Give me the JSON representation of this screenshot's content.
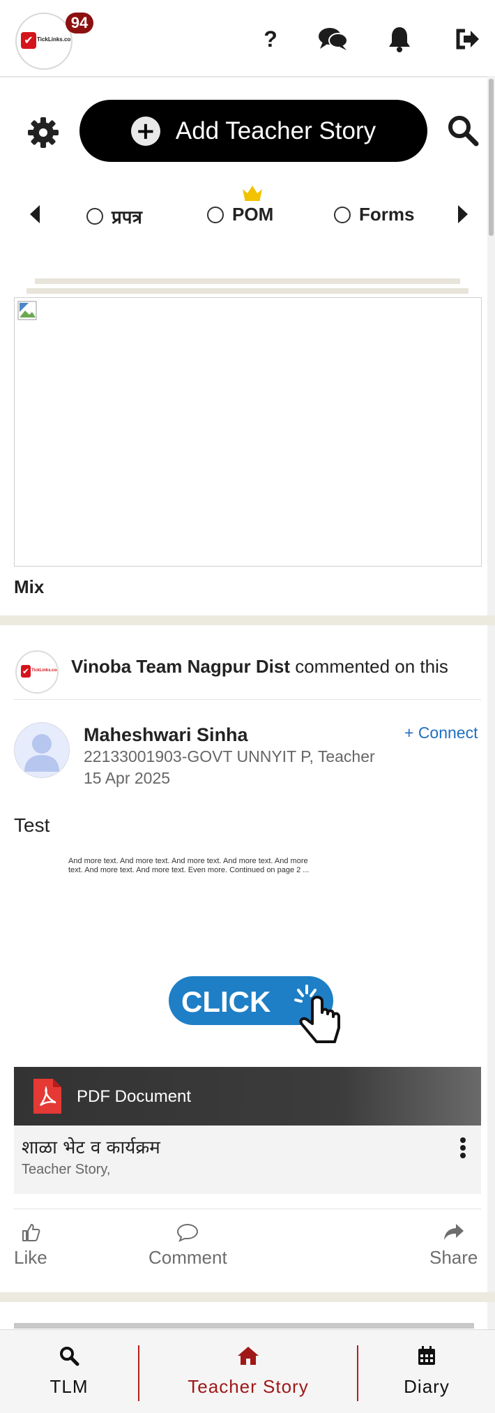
{
  "header": {
    "logo_text": "TickLinks.com",
    "notification_count": "94",
    "icons": [
      "help-icon",
      "chat-icon",
      "bell-icon",
      "logout-icon"
    ]
  },
  "actions": {
    "add_label": "Add Teacher Story"
  },
  "filters": {
    "items": [
      {
        "label": "प्रपत्र",
        "selected": false
      },
      {
        "label": "POM",
        "selected": false,
        "featured": true
      },
      {
        "label": "Forms",
        "selected": false
      }
    ]
  },
  "feed": {
    "card1": {
      "caption": "Mix"
    },
    "card2": {
      "actor": "Vinoba Team Nagpur Dist",
      "action_text": " commented on this",
      "author_name": "Maheshwari Sinha",
      "author_meta": "22133001903-GOVT UNNYIT P, Teacher",
      "date": "15 Apr 2025",
      "connect_label": "+ Connect",
      "post_text": "Test",
      "snippet": "And more text. And more text. And more text. And more text. And more text. And more text. And more text. Even more. Continued on page 2 ...",
      "click_label": "CLICK",
      "attachment_type": "PDF Document",
      "doc_title": "शाळा भेट व कार्यक्रम",
      "doc_category": "Teacher Story,",
      "like_label": "Like",
      "comment_label": "Comment",
      "share_label": "Share"
    }
  },
  "bottom_nav": {
    "items": [
      {
        "label": "TLM",
        "icon": "search-icon"
      },
      {
        "label": "Teacher Story",
        "icon": "home-icon",
        "active": true
      },
      {
        "label": "Diary",
        "icon": "calendar-icon"
      }
    ]
  },
  "colors": {
    "accent": "#8c1010",
    "active_nav": "#a01818",
    "link": "#1f6fc2",
    "crown": "#f2c200"
  }
}
